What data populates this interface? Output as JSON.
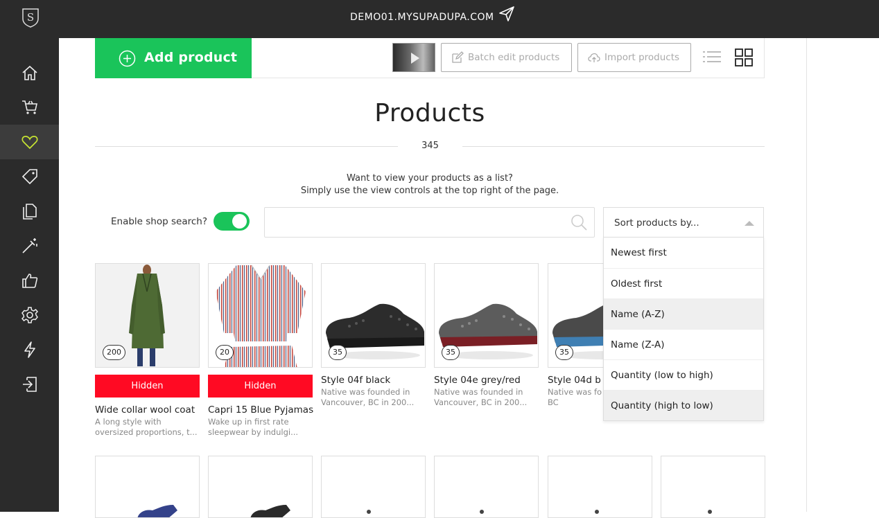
{
  "topbar": {
    "domain": "DEMO01.MYSUPADUPA.COM",
    "logo_letter": "S"
  },
  "sidebar": {
    "items": [
      {
        "name": "home-icon",
        "active": false
      },
      {
        "name": "cart-icon",
        "active": false
      },
      {
        "name": "heart-icon",
        "active": true
      },
      {
        "name": "tag-icon",
        "active": false
      },
      {
        "name": "pages-icon",
        "active": false
      },
      {
        "name": "magic-wand-icon",
        "active": false
      },
      {
        "name": "thumbs-up-icon",
        "active": false
      },
      {
        "name": "gear-icon",
        "active": false
      },
      {
        "name": "lightning-icon",
        "active": false
      },
      {
        "name": "logout-icon",
        "active": false
      }
    ]
  },
  "toolbar": {
    "add_label": "Add product",
    "batch_label": "Batch edit products",
    "import_label": "Import products"
  },
  "main": {
    "title": "Products",
    "count": "345",
    "info_line1": "Want to view your products as a list?",
    "info_line2": "Simply use the view controls at the top right of the page."
  },
  "search": {
    "toggle_label": "Enable shop search?",
    "toggle_on": true,
    "value": "",
    "placeholder": ""
  },
  "sort": {
    "label": "Sort products by...",
    "options": [
      "Newest first",
      "Oldest first",
      "Name (A-Z)",
      "Name (Z-A)",
      "Quantity (low to high)",
      "Quantity (high to low)"
    ]
  },
  "products": [
    {
      "qty": "200",
      "hidden": true,
      "hidden_label": "Hidden",
      "name": "Wide collar wool coat",
      "desc": "A long style with oversized proportions, t..."
    },
    {
      "qty": "20",
      "hidden": true,
      "hidden_label": "Hidden",
      "name": "Capri 15 Blue Pyjamas",
      "desc": "Wake up in first rate sleepwear by indulgi..."
    },
    {
      "qty": "35",
      "hidden": false,
      "name": "Style 04f black",
      "desc": "Native was founded in Vancouver, BC in 200..."
    },
    {
      "qty": "35",
      "hidden": false,
      "name": "Style 04e grey/red",
      "desc": "Native was founded in Vancouver, BC in 200..."
    },
    {
      "qty": "35",
      "hidden": false,
      "name": "Style 04d b",
      "desc": "Native was fo Vancouver, BC"
    }
  ],
  "colors": {
    "accent": "#1ac45a",
    "hidden_badge": "#ff0a23",
    "sidebar": "#2b2b2b",
    "active_icon": "#c8e632"
  }
}
